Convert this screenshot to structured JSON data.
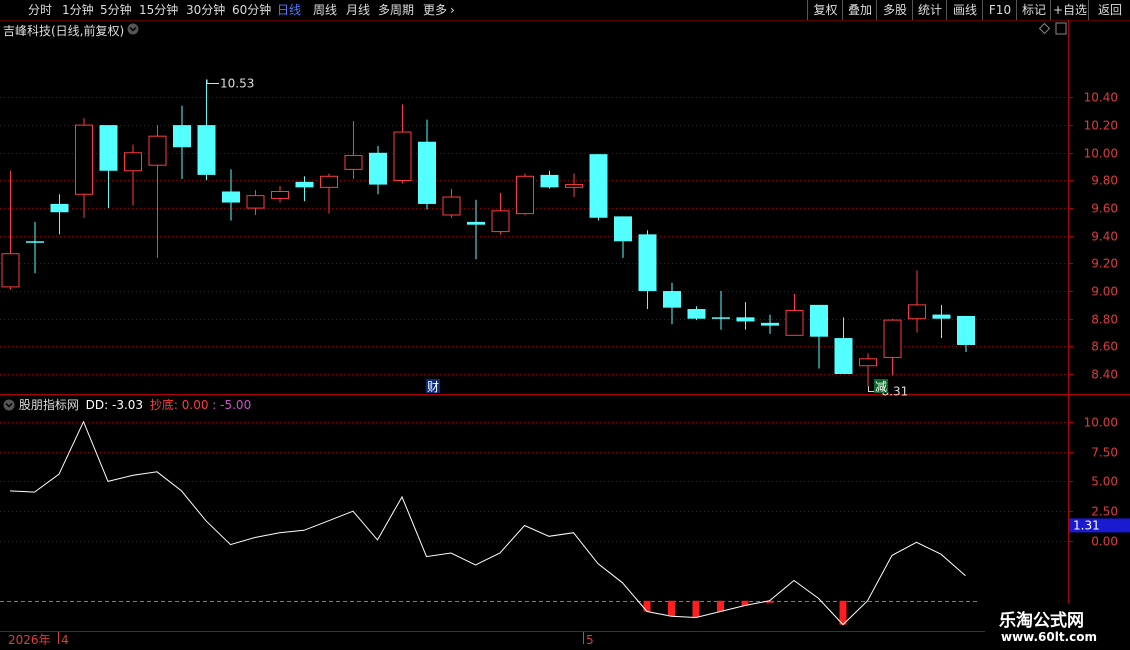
{
  "toolbar": {
    "periods": [
      "分时",
      "1分钟",
      "5分钟",
      "15分钟",
      "30分钟",
      "60分钟",
      "日线",
      "周线",
      "月线",
      "多周期",
      "更多"
    ],
    "active": "日线",
    "right_buttons": [
      "复权",
      "叠加",
      "多股",
      "统计",
      "画线",
      "F10",
      "标记",
      "+自选",
      "返回"
    ]
  },
  "main_title": "吉峰科技(日线,前复权)",
  "indicator": {
    "name": "股朋指标网",
    "dd_label": "DD: -3.03",
    "chaodi_label": "抄底: 0.00",
    "extra_label": ": -5.00"
  },
  "markers": {
    "cai": "财",
    "jian": "减"
  },
  "date_axis": {
    "year": "2026年",
    "labels": [
      "4",
      "5"
    ]
  },
  "logo": {
    "line1": "乐淘公式网",
    "line2": "www.60lt.com"
  },
  "colors": {
    "up": "#ff3c3c",
    "down": "#54ffff",
    "grid": "#8b0000",
    "axis_text": "#dd3c3c",
    "dd_line": "#ffffff",
    "threshold": "#c050c0"
  },
  "chart_data": [
    {
      "type": "candlestick",
      "y_ticks": [
        "10.40",
        "10.20",
        "10.00",
        "9.80",
        "9.60",
        "9.40",
        "9.20",
        "9.00",
        "8.80",
        "8.60",
        "8.40"
      ],
      "ylim": [
        8.27,
        10.83
      ],
      "annotations": [
        {
          "text": "10.53",
          "candle": 8,
          "value": 10.53
        },
        {
          "text": "8.31",
          "candle": 35,
          "value": 8.31
        }
      ],
      "candles": [
        {
          "o": 9.03,
          "h": 9.87,
          "l": 9.01,
          "c": 9.27
        },
        {
          "o": 9.36,
          "h": 9.5,
          "l": 9.13,
          "c": 9.35
        },
        {
          "o": 9.63,
          "h": 9.7,
          "l": 9.41,
          "c": 9.57
        },
        {
          "o": 9.7,
          "h": 10.25,
          "l": 9.53,
          "c": 10.2
        },
        {
          "o": 10.2,
          "h": 10.2,
          "l": 9.6,
          "c": 9.87
        },
        {
          "o": 9.87,
          "h": 10.06,
          "l": 9.62,
          "c": 10.0
        },
        {
          "o": 9.91,
          "h": 10.2,
          "l": 9.24,
          "c": 10.12
        },
        {
          "o": 10.2,
          "h": 10.34,
          "l": 9.81,
          "c": 10.04
        },
        {
          "o": 10.2,
          "h": 10.53,
          "l": 9.8,
          "c": 9.84
        },
        {
          "o": 9.72,
          "h": 9.88,
          "l": 9.51,
          "c": 9.64
        },
        {
          "o": 9.6,
          "h": 9.73,
          "l": 9.55,
          "c": 9.69
        },
        {
          "o": 9.67,
          "h": 9.76,
          "l": 9.64,
          "c": 9.72
        },
        {
          "o": 9.79,
          "h": 9.83,
          "l": 9.65,
          "c": 9.75
        },
        {
          "o": 9.75,
          "h": 9.85,
          "l": 9.56,
          "c": 9.83
        },
        {
          "o": 9.88,
          "h": 10.23,
          "l": 9.81,
          "c": 9.98
        },
        {
          "o": 10.0,
          "h": 10.05,
          "l": 9.7,
          "c": 9.77
        },
        {
          "o": 9.8,
          "h": 10.35,
          "l": 9.78,
          "c": 10.15
        },
        {
          "o": 10.08,
          "h": 10.24,
          "l": 9.59,
          "c": 9.63
        },
        {
          "o": 9.55,
          "h": 9.74,
          "l": 9.53,
          "c": 9.68
        },
        {
          "o": 9.5,
          "h": 9.66,
          "l": 9.23,
          "c": 9.48
        },
        {
          "o": 9.43,
          "h": 9.71,
          "l": 9.41,
          "c": 9.58
        },
        {
          "o": 9.56,
          "h": 9.85,
          "l": 9.55,
          "c": 9.83
        },
        {
          "o": 9.84,
          "h": 9.87,
          "l": 9.74,
          "c": 9.75
        },
        {
          "o": 9.75,
          "h": 9.85,
          "l": 9.68,
          "c": 9.77
        },
        {
          "o": 9.99,
          "h": 9.99,
          "l": 9.51,
          "c": 9.53
        },
        {
          "o": 9.54,
          "h": 9.54,
          "l": 9.24,
          "c": 9.36
        },
        {
          "o": 9.41,
          "h": 9.44,
          "l": 8.87,
          "c": 9.0
        },
        {
          "o": 9.0,
          "h": 9.06,
          "l": 8.76,
          "c": 8.88
        },
        {
          "o": 8.87,
          "h": 8.89,
          "l": 8.79,
          "c": 8.8
        },
        {
          "o": 8.81,
          "h": 9.0,
          "l": 8.72,
          "c": 8.8
        },
        {
          "o": 8.81,
          "h": 8.92,
          "l": 8.72,
          "c": 8.78
        },
        {
          "o": 8.77,
          "h": 8.83,
          "l": 8.69,
          "c": 8.75
        },
        {
          "o": 8.68,
          "h": 8.98,
          "l": 8.68,
          "c": 8.86
        },
        {
          "o": 8.9,
          "h": 8.9,
          "l": 8.44,
          "c": 8.67
        },
        {
          "o": 8.66,
          "h": 8.81,
          "l": 8.4,
          "c": 8.4
        },
        {
          "o": 8.46,
          "h": 8.55,
          "l": 8.31,
          "c": 8.51
        },
        {
          "o": 8.52,
          "h": 8.8,
          "l": 8.39,
          "c": 8.79
        },
        {
          "o": 8.8,
          "h": 9.15,
          "l": 8.7,
          "c": 8.9
        },
        {
          "o": 8.83,
          "h": 8.9,
          "l": 8.66,
          "c": 8.8
        },
        {
          "o": 8.82,
          "h": 8.82,
          "l": 8.56,
          "c": 8.61
        }
      ]
    },
    {
      "type": "line",
      "series_name": "DD",
      "y_ticks": [
        "10.00",
        "7.50",
        "5.00",
        "2.50",
        "0.00"
      ],
      "ylim": [
        -7.45,
        12.15
      ],
      "current_value_label": "1.31",
      "threshold": -5.0,
      "values": [
        4.2,
        4.1,
        5.6,
        10.0,
        5.0,
        5.5,
        5.8,
        4.2,
        1.7,
        -0.3,
        0.3,
        0.7,
        0.9,
        1.7,
        2.5,
        0.1,
        3.7,
        -1.3,
        -1.0,
        -2.0,
        -1.0,
        1.3,
        0.4,
        0.7,
        -1.9,
        -3.5,
        -5.9,
        -6.3,
        -6.4,
        -5.9,
        -5.4,
        -5.0,
        -3.3,
        -4.8,
        -7.0,
        -5.0,
        -1.2,
        -0.1,
        -1.1,
        -2.9
      ],
      "chaodi_bars": [
        {
          "candle": 26,
          "value": -5.9
        },
        {
          "candle": 27,
          "value": -6.3
        },
        {
          "candle": 28,
          "value": -6.4
        },
        {
          "candle": 29,
          "value": -5.9
        },
        {
          "candle": 30,
          "value": -5.4
        },
        {
          "candle": 31,
          "value": -5.0
        },
        {
          "candle": 34,
          "value": -7.0
        }
      ]
    }
  ]
}
